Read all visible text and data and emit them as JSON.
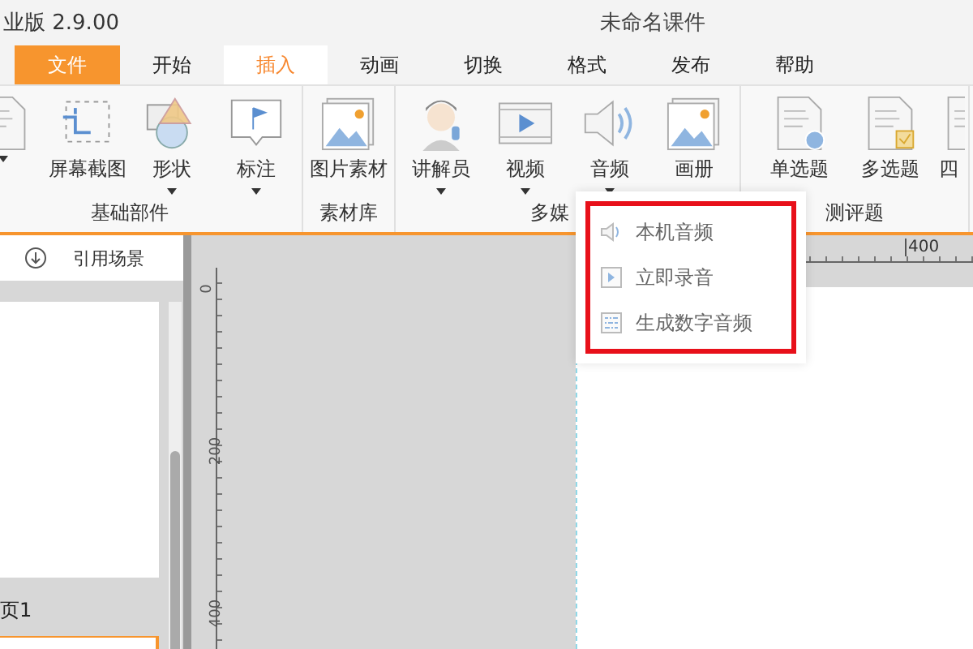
{
  "window": {
    "edition": "业版 2.9.00",
    "title": "未命名课件"
  },
  "tabs": [
    {
      "label": "文件",
      "kind": "file",
      "selected": false
    },
    {
      "label": "开始",
      "kind": "tab",
      "selected": false
    },
    {
      "label": "插入",
      "kind": "tab",
      "selected": true
    },
    {
      "label": "动画",
      "kind": "tab",
      "selected": false
    },
    {
      "label": "切换",
      "kind": "tab",
      "selected": false
    },
    {
      "label": "格式",
      "kind": "tab",
      "selected": false
    },
    {
      "label": "发布",
      "kind": "tab",
      "selected": false
    },
    {
      "label": "帮助",
      "kind": "tab",
      "selected": false
    }
  ],
  "ribbon": [
    {
      "label": "基础部件",
      "buttons": [
        {
          "kind": "doc",
          "dropdown": true
        },
        {
          "label": "屏幕截图",
          "kind": "crop",
          "dropdown": false
        },
        {
          "label": "形状",
          "kind": "shape",
          "dropdown": true
        },
        {
          "label": "标注",
          "kind": "flag",
          "dropdown": true
        }
      ]
    },
    {
      "label": "素材库",
      "buttons": [
        {
          "label": "图片素材",
          "kind": "image",
          "dropdown": false
        }
      ]
    },
    {
      "label": "多媒",
      "buttons": [
        {
          "label": "讲解员",
          "kind": "person",
          "dropdown": true
        },
        {
          "label": "视频",
          "kind": "video",
          "dropdown": true
        },
        {
          "label": "音频",
          "kind": "speaker",
          "dropdown": true
        },
        {
          "label": "画册",
          "kind": "album",
          "dropdown": false
        }
      ]
    },
    {
      "label": "测评题",
      "buttons": [
        {
          "label": "单选题",
          "kind": "single",
          "dropdown": false
        },
        {
          "label": "多选题",
          "kind": "multi",
          "dropdown": false
        },
        {
          "label": "四",
          "kind": "doc",
          "dropdown": false
        }
      ]
    }
  ],
  "audio_menu": [
    {
      "label": "本机音频",
      "kind": "speaker"
    },
    {
      "label": "立即录音",
      "kind": "play"
    },
    {
      "label": "生成数字音频",
      "kind": "binary"
    }
  ],
  "left_panel": {
    "action": "引用场景",
    "slide_label": "页1"
  },
  "rulers": {
    "horizontal": [
      "400"
    ],
    "vertical": [
      "0",
      "200",
      "400"
    ]
  }
}
